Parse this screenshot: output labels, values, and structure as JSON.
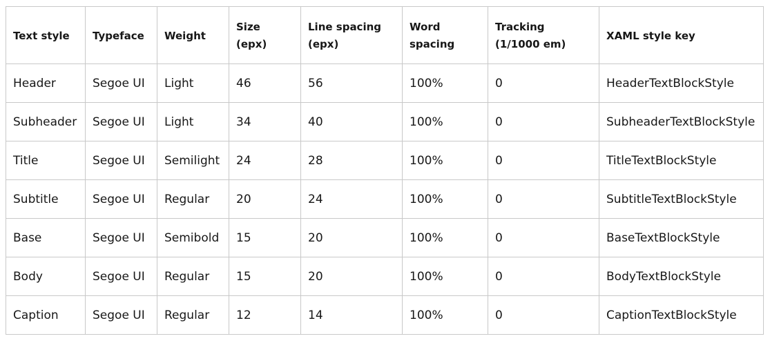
{
  "table": {
    "headers": [
      "Text style",
      "Typeface",
      "Weight",
      "Size (epx)",
      "Line spacing (epx)",
      "Word spacing",
      "Tracking (1/1000 em)",
      "XAML style key"
    ],
    "rows": [
      [
        "Header",
        "Segoe UI",
        "Light",
        "46",
        "56",
        "100%",
        "0",
        "HeaderTextBlockStyle"
      ],
      [
        "Subheader",
        "Segoe UI",
        "Light",
        "34",
        "40",
        "100%",
        "0",
        "SubheaderTextBlockStyle"
      ],
      [
        "Title",
        "Segoe UI",
        "Semilight",
        "24",
        "28",
        "100%",
        "0",
        "TitleTextBlockStyle"
      ],
      [
        "Subtitle",
        "Segoe UI",
        "Regular",
        "20",
        "24",
        "100%",
        "0",
        "SubtitleTextBlockStyle"
      ],
      [
        "Base",
        "Segoe UI",
        "Semibold",
        "15",
        "20",
        "100%",
        "0",
        "BaseTextBlockStyle"
      ],
      [
        "Body",
        "Segoe UI",
        "Regular",
        "15",
        "20",
        "100%",
        "0",
        "BodyTextBlockStyle"
      ],
      [
        "Caption",
        "Segoe UI",
        "Regular",
        "12",
        "14",
        "100%",
        "0",
        "CaptionTextBlockStyle"
      ]
    ]
  }
}
